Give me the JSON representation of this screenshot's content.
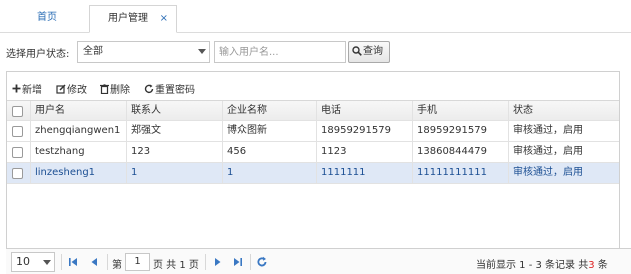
{
  "tabs": {
    "home": "首页",
    "user_mgmt": "用户管理",
    "close": "×"
  },
  "search": {
    "status_label": "选择用户状态:",
    "status_value": "全部",
    "name_placeholder": "输入用户名...",
    "query_label": "查询"
  },
  "toolbar": {
    "add": "新增",
    "edit": "修改",
    "delete": "删除",
    "reset_pwd": "重置密码"
  },
  "table": {
    "columns": [
      "用户名",
      "联系人",
      "企业名称",
      "电话",
      "手机",
      "状态"
    ],
    "rows": [
      [
        "zhengqiangwen1",
        "郑强文",
        "博众图新",
        "18959291579",
        "18959291579",
        "审核通过，启用"
      ],
      [
        "testzhang",
        "123",
        "456",
        "1123",
        "13860844479",
        "审核通过，启用"
      ],
      [
        "linzesheng1",
        "1",
        "1",
        "1111111",
        "11111111111",
        "审核通过，启用"
      ]
    ]
  },
  "pager": {
    "page_size": "10",
    "page_prefix": "第",
    "page_value": "1",
    "page_suffix": "页 共 1 页",
    "info_prefix": "当前显示 1 - 3 条记录 共",
    "info_count": "3",
    "info_suffix": " 条"
  },
  "colors": {
    "link_blue": "#2a6db5",
    "selected_row": "#dfe8f6",
    "icon_blue": "#3a78c3"
  }
}
